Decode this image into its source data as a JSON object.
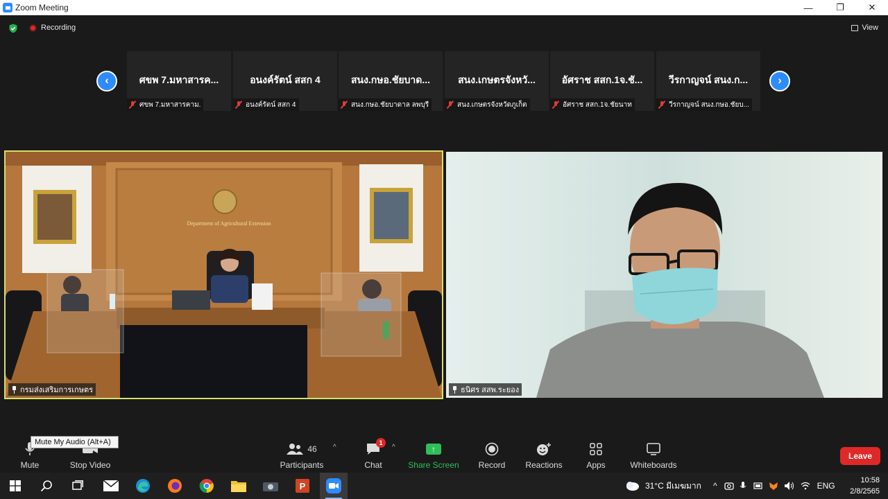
{
  "window": {
    "title": "Zoom Meeting",
    "minimize": "—",
    "restore": "❐",
    "close": "✕"
  },
  "topbar": {
    "recording_label": "Recording",
    "view_label": "View"
  },
  "thumbnails": [
    {
      "name": "ศขพ 7.มหาสารค...",
      "label": "ศขพ 7.มหาสารคาม."
    },
    {
      "name": "อนงค์รัตน์ สสก 4",
      "label": "อนงค์รัตน์ สสก 4"
    },
    {
      "name": "สนง.กษอ.ชัยบาด...",
      "label": "สนง.กษอ.ชัยบาดาล ลพบุรี"
    },
    {
      "name": "สนง.เกษตรจังหวั...",
      "label": "สนง.เกษตรจังหวัดภูเก็ต"
    },
    {
      "name": "อัศราช สสก.1จ.ชั...",
      "label": "อัศราช  สสก.1จ.ชัยนาท"
    },
    {
      "name": "วีรกาญจน์ สนง.ก...",
      "label": "วีรกาญจน์ สนง.กษอ.ชัยบ..."
    }
  ],
  "videos": {
    "left": {
      "label": "กรมส่งเสริมการเกษตร",
      "sign_text": "Department of Agricultural Extension"
    },
    "right": {
      "label": "ธนิศร สสพ.ระยอง"
    }
  },
  "toolbar": {
    "mute": "Mute",
    "mute_tooltip": "Mute My Audio (Alt+A)",
    "stop_video": "Stop Video",
    "participants": "Participants",
    "participants_count": "46",
    "chat": "Chat",
    "chat_badge": "1",
    "share_screen": "Share Screen",
    "record": "Record",
    "reactions": "Reactions",
    "apps": "Apps",
    "whiteboards": "Whiteboards",
    "leave": "Leave"
  },
  "taskbar": {
    "weather": "31°C  มีเมฆมาก",
    "language": "ENG",
    "time": "10:58",
    "date": "2/8/2565"
  },
  "colors": {
    "accent": "#2d8cff",
    "leave": "#e02828",
    "share": "#2fbe5a",
    "active_speaker_border": "#d8e06a"
  }
}
